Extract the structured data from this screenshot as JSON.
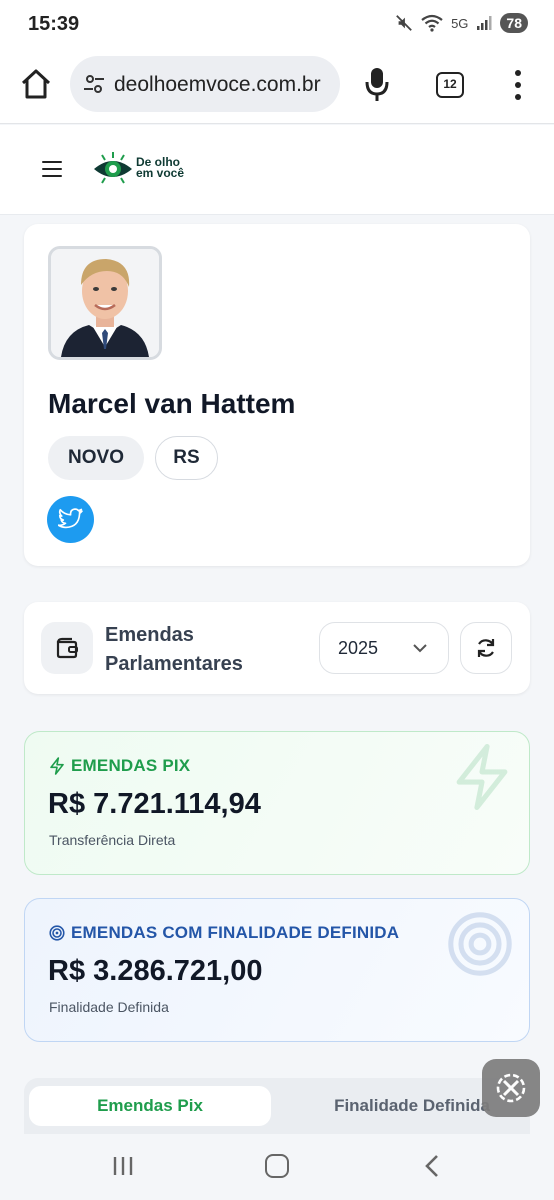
{
  "status_bar": {
    "time": "15:39",
    "network": "5G",
    "battery": "78"
  },
  "browser": {
    "url": "deolhoemvoce.com.br",
    "tab_count": "12"
  },
  "site": {
    "logo_line1": "De olho",
    "logo_line2": "em você",
    "brand_color": "#1f9d4c"
  },
  "profile": {
    "name": "Marcel van Hattem",
    "party": "NOVO",
    "state": "RS",
    "social_icon": "twitter-icon"
  },
  "emendas_panel": {
    "title_line1": "Emendas",
    "title_line2": "Parlamentares",
    "year": "2025"
  },
  "stats": {
    "pix": {
      "label": "EMENDAS PIX",
      "amount": "R$ 7.721.114,94",
      "description": "Transferência Direta",
      "color": "#1f9d4c"
    },
    "finalidade": {
      "label": "EMENDAS COM FINALIDADE DEFINIDA",
      "amount": "R$ 3.286.721,00",
      "description": "Finalidade Definida",
      "color": "#2456a8"
    }
  },
  "tabs": {
    "active": "Emendas Pix",
    "inactive": "Finalidade Definida"
  }
}
